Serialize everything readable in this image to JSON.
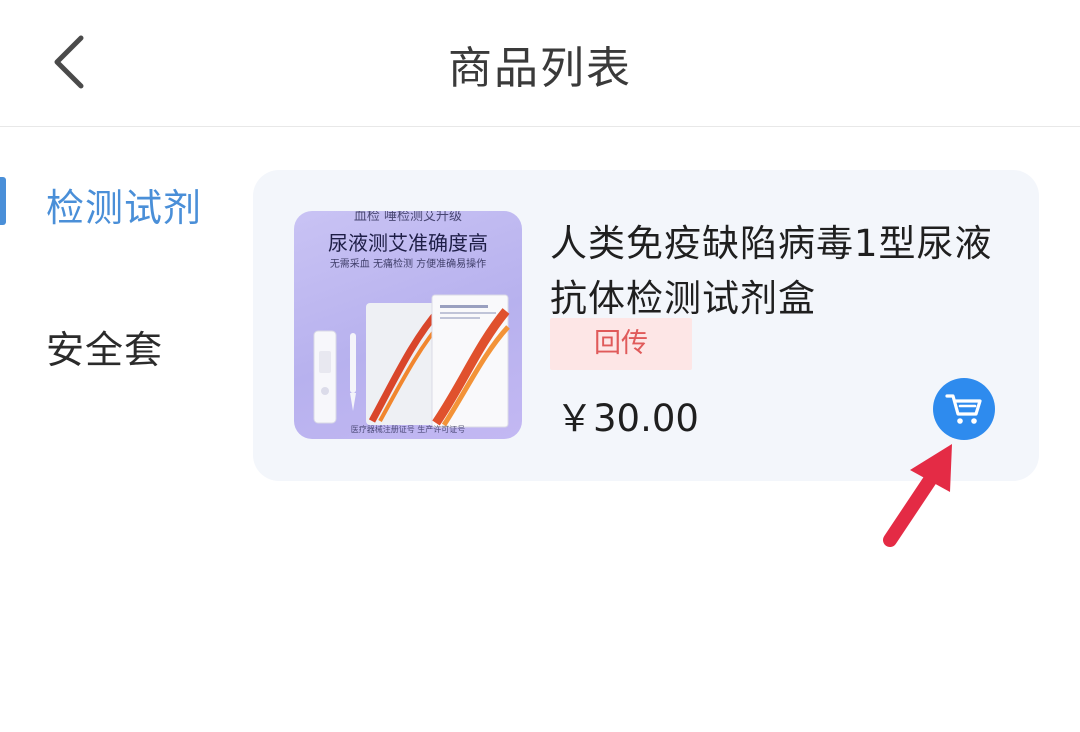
{
  "header": {
    "title": "商品列表",
    "back_icon": "chevron-left-icon"
  },
  "sidebar": {
    "items": [
      {
        "label": "检测试剂",
        "active": true
      },
      {
        "label": "安全套",
        "active": false
      }
    ]
  },
  "product": {
    "name": "人类免疫缺陷病毒1型尿液抗体检测试剂盒",
    "tag": "回传",
    "price": "￥30.00",
    "cart_icon": "shopping-cart-icon",
    "image_text": {
      "line1": "血检 唾检测艾升级",
      "line2": "尿液测艾准确度高",
      "line3": "无需采血 无痛检测  方便准确易操作",
      "line4": "医疗器械注册证号 生产许可证号"
    }
  },
  "colors": {
    "accent": "#4a8fd8",
    "cart_button": "#2e8bee",
    "tag_bg": "#fde6e6",
    "tag_text": "#e05a5a",
    "card_bg": "#f3f6fb",
    "annotation_arrow": "#e42b45"
  }
}
